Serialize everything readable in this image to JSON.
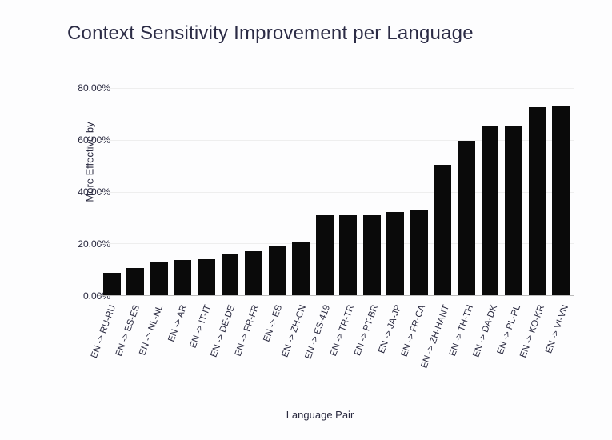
{
  "chart_data": {
    "type": "bar",
    "title": "Context Sensitivity Improvement per Language",
    "xlabel": "Language Pair",
    "ylabel": "More Effective by",
    "ylim": [
      0,
      80
    ],
    "yticks": [
      0,
      20,
      40,
      60,
      80
    ],
    "ytick_labels": [
      "0.00%",
      "20.00%",
      "40.00%",
      "60.00%",
      "80.00%"
    ],
    "categories": [
      "EN -> RU-RU",
      "EN -> ES-ES",
      "EN -> NL-NL",
      "EN -> AR",
      "EN -> IT-IT",
      "EN -> DE-DE",
      "EN -> FR-FR",
      "EN -> ES",
      "EN -> ZH-CN",
      "EN -> ES-419",
      "EN -> TR-TR",
      "EN -> PT-BR",
      "EN -> JA-JP",
      "EN -> FR-CA",
      "EN -> ZH-HANT",
      "EN -> TH-TH",
      "EN -> DA-DK",
      "EN -> PL-PL",
      "EN -> KO-KR",
      "EN -> VI-VN"
    ],
    "values": [
      8.5,
      10.5,
      13.0,
      13.5,
      14.0,
      16.0,
      17.0,
      19.0,
      20.5,
      31.0,
      31.0,
      31.0,
      32.0,
      33.0,
      50.5,
      59.5,
      65.5,
      65.5,
      72.5,
      73.0
    ]
  }
}
